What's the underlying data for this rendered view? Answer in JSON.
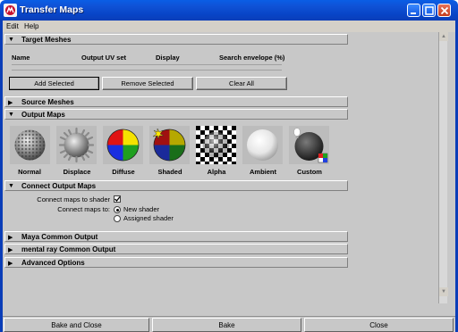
{
  "window": {
    "title": "Transfer Maps",
    "colors": {
      "titlebar": "#0a4fd4",
      "panel": "#c8c8c8",
      "close_button": "#d9532f"
    }
  },
  "menubar": {
    "items": [
      "Edit",
      "Help"
    ]
  },
  "target_meshes": {
    "label": "Target Meshes",
    "columns": [
      "Name",
      "Output UV set",
      "Display",
      "Search envelope (%)"
    ],
    "buttons": {
      "add": "Add Selected",
      "remove": "Remove Selected",
      "clear": "Clear All"
    }
  },
  "source_meshes": {
    "label": "Source Meshes"
  },
  "output_maps": {
    "label": "Output Maps",
    "maps": [
      {
        "label": "Normal",
        "icon": "normal-map-icon"
      },
      {
        "label": "Displace",
        "icon": "displace-map-icon"
      },
      {
        "label": "Diffuse",
        "icon": "diffuse-map-icon"
      },
      {
        "label": "Shaded",
        "icon": "shaded-map-icon"
      },
      {
        "label": "Alpha",
        "icon": "alpha-map-icon"
      },
      {
        "label": "Ambient",
        "icon": "ambient-map-icon"
      },
      {
        "label": "Custom",
        "icon": "custom-map-icon"
      }
    ]
  },
  "connect_output_maps": {
    "label": "Connect Output Maps",
    "connect_to_shader_label": "Connect maps to shader",
    "connect_to_shader_checked": true,
    "connect_to_label": "Connect maps to:",
    "options": [
      "New shader",
      "Assigned shader"
    ],
    "selected": "New shader"
  },
  "collapsed_sections": [
    "Maya Common Output",
    "mental ray Common Output",
    "Advanced Options"
  ],
  "footer": {
    "bake_close": "Bake and Close",
    "bake": "Bake",
    "close": "Close"
  }
}
